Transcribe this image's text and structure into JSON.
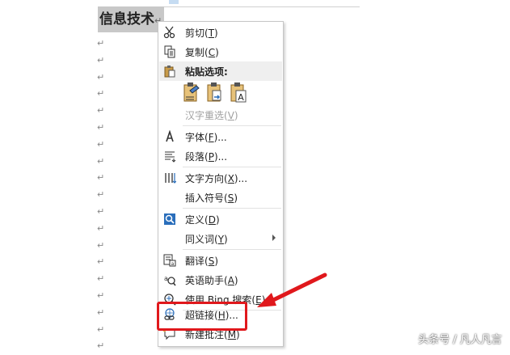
{
  "document": {
    "heading": "信息技术",
    "paragraph_mark": "↵",
    "empty_paragraph_count": 19
  },
  "context_menu": {
    "items": [
      {
        "label": "剪切(",
        "hotkey": "T",
        "suffix": ")",
        "icon": "scissors-icon"
      },
      {
        "label": "复制(",
        "hotkey": "C",
        "suffix": ")",
        "icon": "copy-icon"
      },
      {
        "label": "粘贴选项:",
        "icon": "paste-icon"
      },
      {
        "label": "汉字重选(",
        "hotkey": "V",
        "suffix": ")"
      },
      {
        "label": "字体(",
        "hotkey": "F",
        "suffix": ")...",
        "icon": "font-icon"
      },
      {
        "label": "段落(",
        "hotkey": "P",
        "suffix": ")...",
        "icon": "paragraph-icon"
      },
      {
        "label": "文字方向(",
        "hotkey": "X",
        "suffix": ")...",
        "icon": "text-direction-icon"
      },
      {
        "label": "插入符号(",
        "hotkey": "S",
        "suffix": ")"
      },
      {
        "label": "定义(",
        "hotkey": "D",
        "suffix": ")",
        "icon": "define-icon"
      },
      {
        "label": "同义词(",
        "hotkey": "Y",
        "suffix": ")"
      },
      {
        "label": "翻译(",
        "hotkey": "S",
        "suffix": ")",
        "icon": "translate-icon"
      },
      {
        "label": "英语助手(",
        "hotkey": "A",
        "suffix": ")",
        "icon": "english-assistant-icon"
      },
      {
        "label": "使用 Bing 搜索(",
        "hotkey": "E",
        "suffix": ")",
        "icon": "bing-search-icon"
      },
      {
        "label": "超链接(",
        "hotkey": "H",
        "suffix": ")...",
        "icon": "hyperlink-icon"
      },
      {
        "label": "新建批注(",
        "hotkey": "M",
        "suffix": ")",
        "icon": "new-comment-icon"
      }
    ],
    "paste_option_glyph": "A"
  },
  "annotation": {
    "highlight_color": "#e0181c",
    "highlighted_item": "超链接(H)..."
  },
  "watermark": "头条号 / 凡人凡言",
  "colors": {
    "menu_border": "#c6c6c6",
    "section_header_bg": "#efefef",
    "heading_highlight": "#c8c8c8",
    "icon_blue": "#2a6ebb"
  }
}
